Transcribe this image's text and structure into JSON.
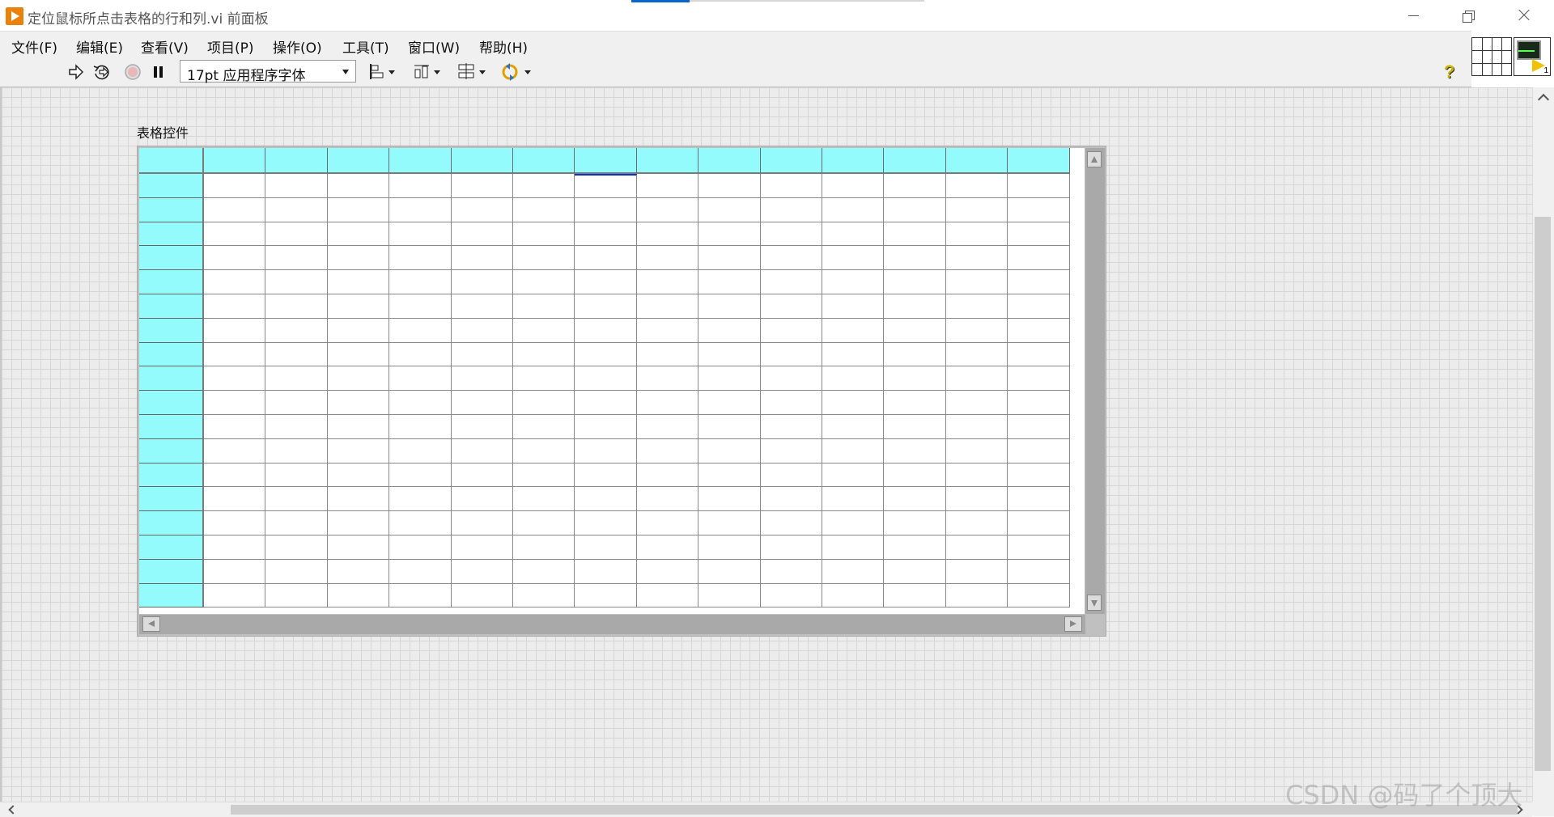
{
  "window": {
    "title": "定位鼠标所点击表格的行和列.vi 前面板",
    "minimize_glyph": "",
    "close_glyph": ""
  },
  "menu": [
    {
      "label": "文件(F)"
    },
    {
      "label": "编辑(E)"
    },
    {
      "label": "查看(V)"
    },
    {
      "label": "项目(P)"
    },
    {
      "label": "操作(O)"
    },
    {
      "label": "工具(T)"
    },
    {
      "label": "窗口(W)"
    },
    {
      "label": "帮助(H)"
    }
  ],
  "toolbar": {
    "run_icon": "run-arrow-icon",
    "run_continuously_icon": "run-continuously-icon",
    "abort_icon": "abort-stop-icon",
    "pause_icon": "pause-icon",
    "font_select": "17pt 应用程序字体",
    "align_icon": "align-objects-icon",
    "distribute_icon": "distribute-objects-icon",
    "resize_icon": "resize-objects-icon",
    "reorder_icon": "reorder-icon",
    "help_icon": "context-help-icon",
    "pause_glyph": "❚❚",
    "run_glyph": "⇨",
    "run_cont_glyph": "⟲",
    "help_glyph": "?"
  },
  "vi_icon": {
    "badge": "1"
  },
  "table_control": {
    "label": "表格控件",
    "columns": 14,
    "rows": 18,
    "active_cell": {
      "row": 0,
      "col": 6
    },
    "header_color": "#94fbfd"
  },
  "watermark": "CSDN @码了个顶大"
}
